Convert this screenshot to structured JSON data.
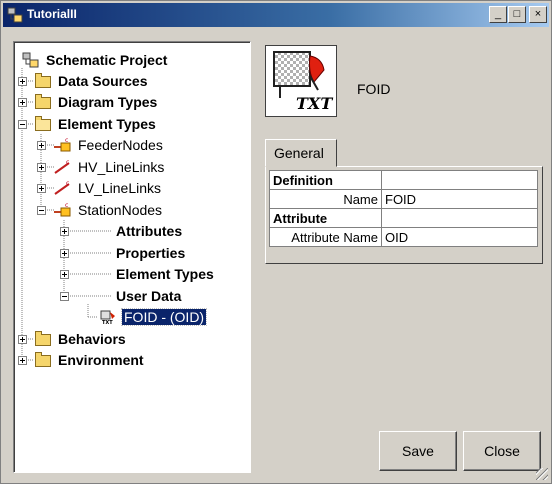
{
  "window": {
    "title": "TutorialII",
    "min_glyph": "_",
    "max_glyph": "□",
    "close_glyph": "×"
  },
  "tree": {
    "root": "Schematic Project",
    "data_sources": "Data Sources",
    "diagram_types": "Diagram Types",
    "element_types": "Element Types",
    "feeder_nodes": "FeederNodes",
    "hv_linelinks": "HV_LineLinks",
    "lv_linelinks": "LV_LineLinks",
    "station_nodes": "StationNodes",
    "attributes": "Attributes",
    "properties": "Properties",
    "element_types_child": "Element Types",
    "user_data": "User Data",
    "foid_oid": "FOID - (OID)",
    "behaviors": "Behaviors",
    "environment": "Environment"
  },
  "detail": {
    "name": "FOID",
    "icon_text": "TXT",
    "tab": "General",
    "definition_header": "Definition",
    "name_label": "Name",
    "name_value": "FOID",
    "attribute_header": "Attribute",
    "attribute_name_label": "Attribute Name",
    "attribute_name_value": "OID"
  },
  "buttons": {
    "save": "Save",
    "close": "Close"
  },
  "colors": {
    "selection": "#0a246a",
    "title_gradient_start": "#0a246a",
    "folder": "#f5d56b"
  }
}
